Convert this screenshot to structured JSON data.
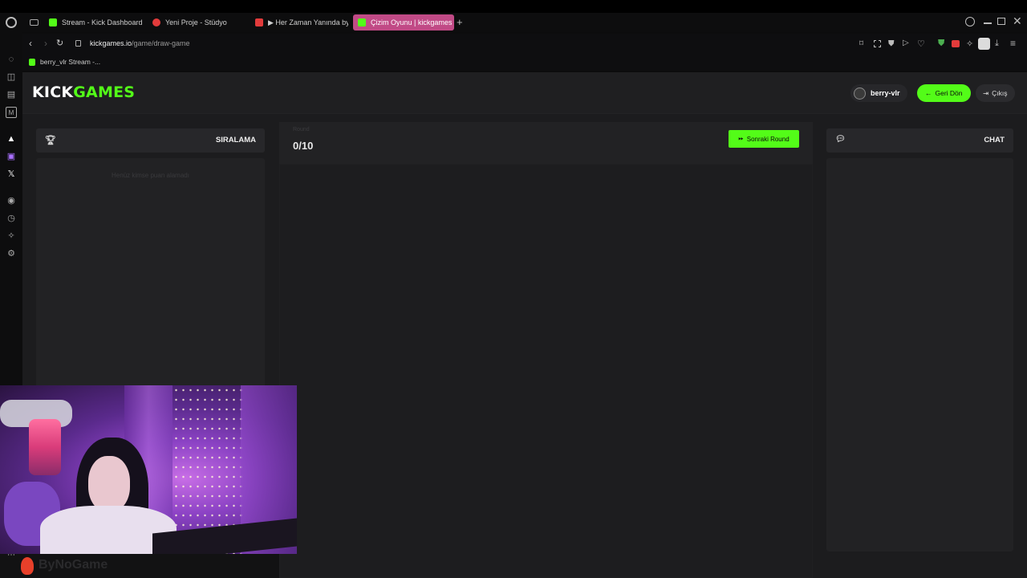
{
  "browser": {
    "tabs": [
      {
        "label": "Stream - Kick Dashboard",
        "favicon_color": "#53fc18"
      },
      {
        "label": "Yeni Proje - Stüdyo",
        "favicon_color": "#e23b3b"
      },
      {
        "label": "▶ Her Zaman Yanında by",
        "favicon_color": "#e23b3b"
      },
      {
        "label": "Çizim Oyunu | kickgames",
        "favicon_color": "#53fc18",
        "active": true
      }
    ],
    "url_domain": "kickgames.io",
    "url_path": "/game/draw-game",
    "bookmark": "berry_vlr Stream -..."
  },
  "header": {
    "logo_part1": "KICK",
    "logo_part2": "GAMES",
    "username": "berry-vlr",
    "back_button": "Geri Dön",
    "logout_button": "Çıkış"
  },
  "leaderboard": {
    "title": "SIRALAMA",
    "empty_text": "Henüz kimse puan alamadı"
  },
  "game": {
    "round_label": "Round",
    "round_counter": "0/10",
    "next_round_button": "Sonraki Round"
  },
  "chat": {
    "title": "CHAT"
  },
  "overlay": {
    "watermark": "ByNoGame"
  },
  "colors": {
    "accent": "#53fc18",
    "active_tab": "#c14a86",
    "panel": "#27272a"
  }
}
